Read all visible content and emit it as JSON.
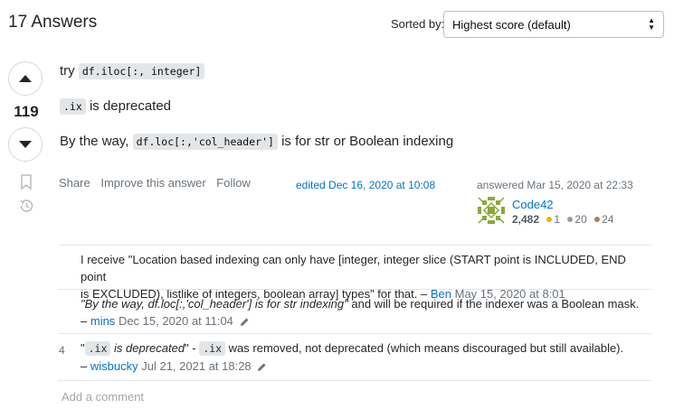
{
  "header": {
    "answers_title": "17 Answers",
    "sort_label": "Sorted by:",
    "sort_value": "Highest score (default)"
  },
  "vote": {
    "score": "119"
  },
  "answer": {
    "line1_text": "try",
    "line1_code": "df.iloc[:, integer]",
    "line2_code": ".ix",
    "line2_text": "is deprecated",
    "line3_text_a": "By the way,",
    "line3_code": "df.loc[:,'col_header']",
    "line3_text_b": "is for str or Boolean indexing"
  },
  "post_menu": {
    "share": "Share",
    "improve": "Improve this answer",
    "follow": "Follow"
  },
  "edited": "edited Dec 16, 2020 at 10:08",
  "answered": "answered Mar 15, 2020 at 22:33",
  "user": {
    "name": "Code42",
    "reputation": "2,482",
    "gold": "1",
    "silver": "20",
    "bronze": "24"
  },
  "colors": {
    "gold": "#f1b600",
    "silver": "#9a9c9f",
    "bronze": "#ab825f",
    "link": "#0074cc"
  },
  "comments": [
    {
      "score": "",
      "text_line1": "I receive \"Location based indexing can only have [integer, integer slice (START point is INCLUDED, END point",
      "text_line2": "is EXCLUDED), listlike of integers, boolean array] types\" for that. –",
      "user": "Ben",
      "date": "May 15, 2020 at 8:01"
    },
    {
      "score": "",
      "text_italic": "\"By the way, df.loc[:,'col_header'] is for str indexing\"",
      "text_rest": " and will be required if the indexer was a Boolean mask.",
      "dash": "–",
      "user": "mins",
      "date": "Dec 15, 2020 at 11:04"
    },
    {
      "score": "4",
      "q_open": "\"",
      "code1": ".ix",
      "italic": " is deprecated",
      "q_close": "\" -",
      "code2": ".ix",
      "rest": "was removed, not deprecated (which means discouraged but still available).",
      "dash": "–",
      "user": "wisbucky",
      "date": "Jul 21, 2021 at 18:28"
    }
  ],
  "add_comment": "Add a comment"
}
